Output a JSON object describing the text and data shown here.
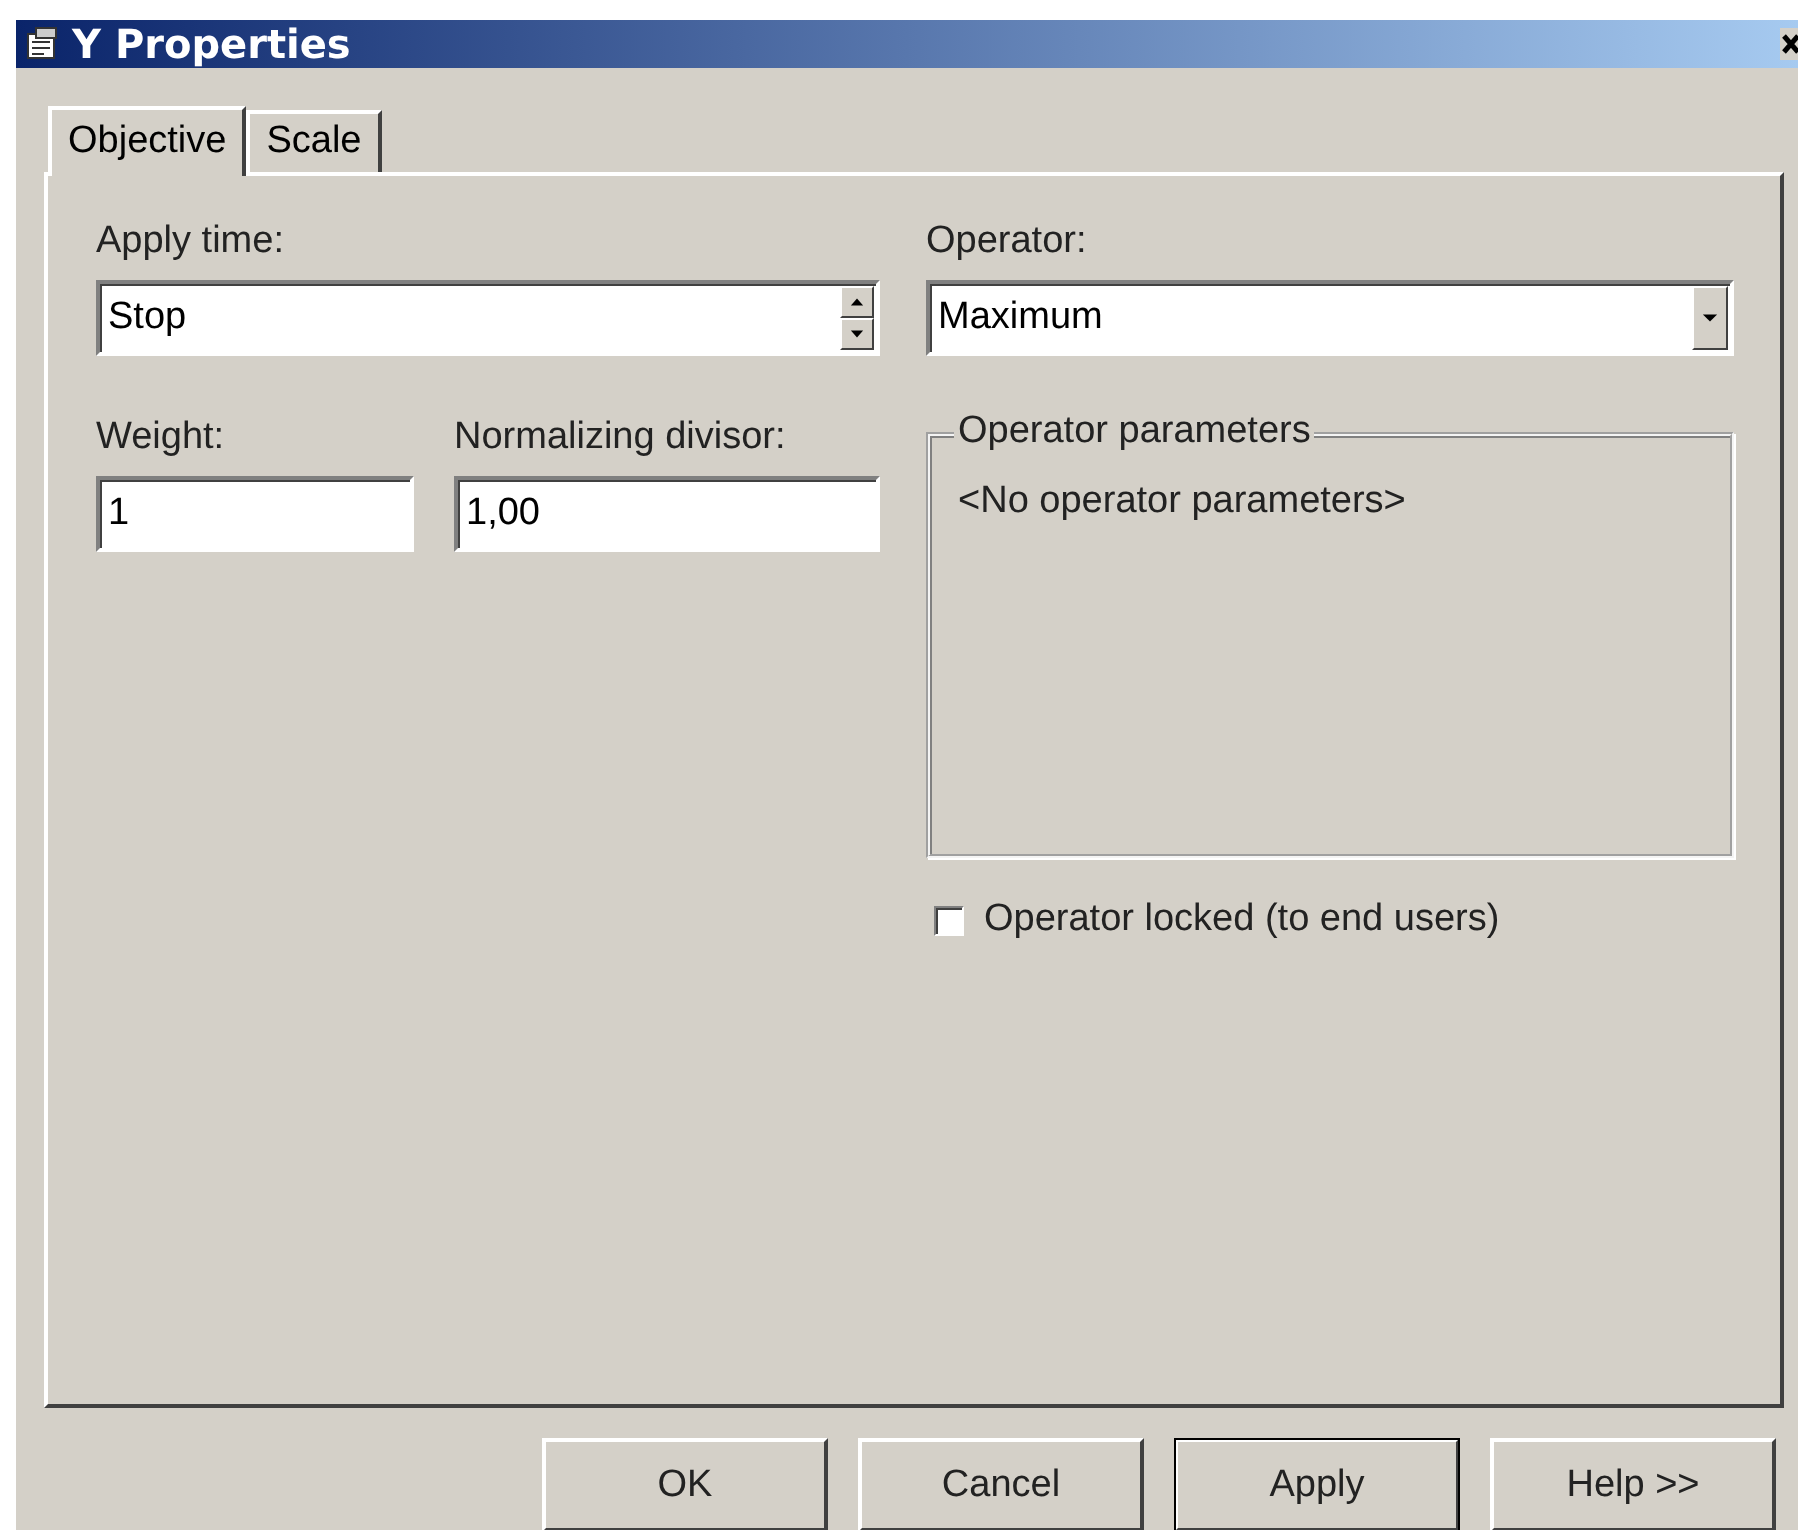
{
  "window": {
    "title": "Y Properties"
  },
  "tabs": [
    {
      "label": "Objective",
      "selected": true
    },
    {
      "label": "Scale",
      "selected": false
    }
  ],
  "apply_time": {
    "label": "Apply time:",
    "value": "Stop"
  },
  "weight": {
    "label": "Weight:",
    "value": "1"
  },
  "normalizing_divisor": {
    "label": "Normalizing divisor:",
    "value": "1,00"
  },
  "operator": {
    "label": "Operator:",
    "value": "Maximum"
  },
  "operator_parameters": {
    "title": "Operator parameters",
    "text": "<No operator parameters>"
  },
  "operator_locked": {
    "label": "Operator locked (to end users)",
    "checked": false
  },
  "buttons": [
    {
      "label": "OK",
      "default": false
    },
    {
      "label": "Cancel",
      "default": false
    },
    {
      "label": "Apply",
      "default": true
    },
    {
      "label": "Help >>",
      "default": false
    }
  ]
}
